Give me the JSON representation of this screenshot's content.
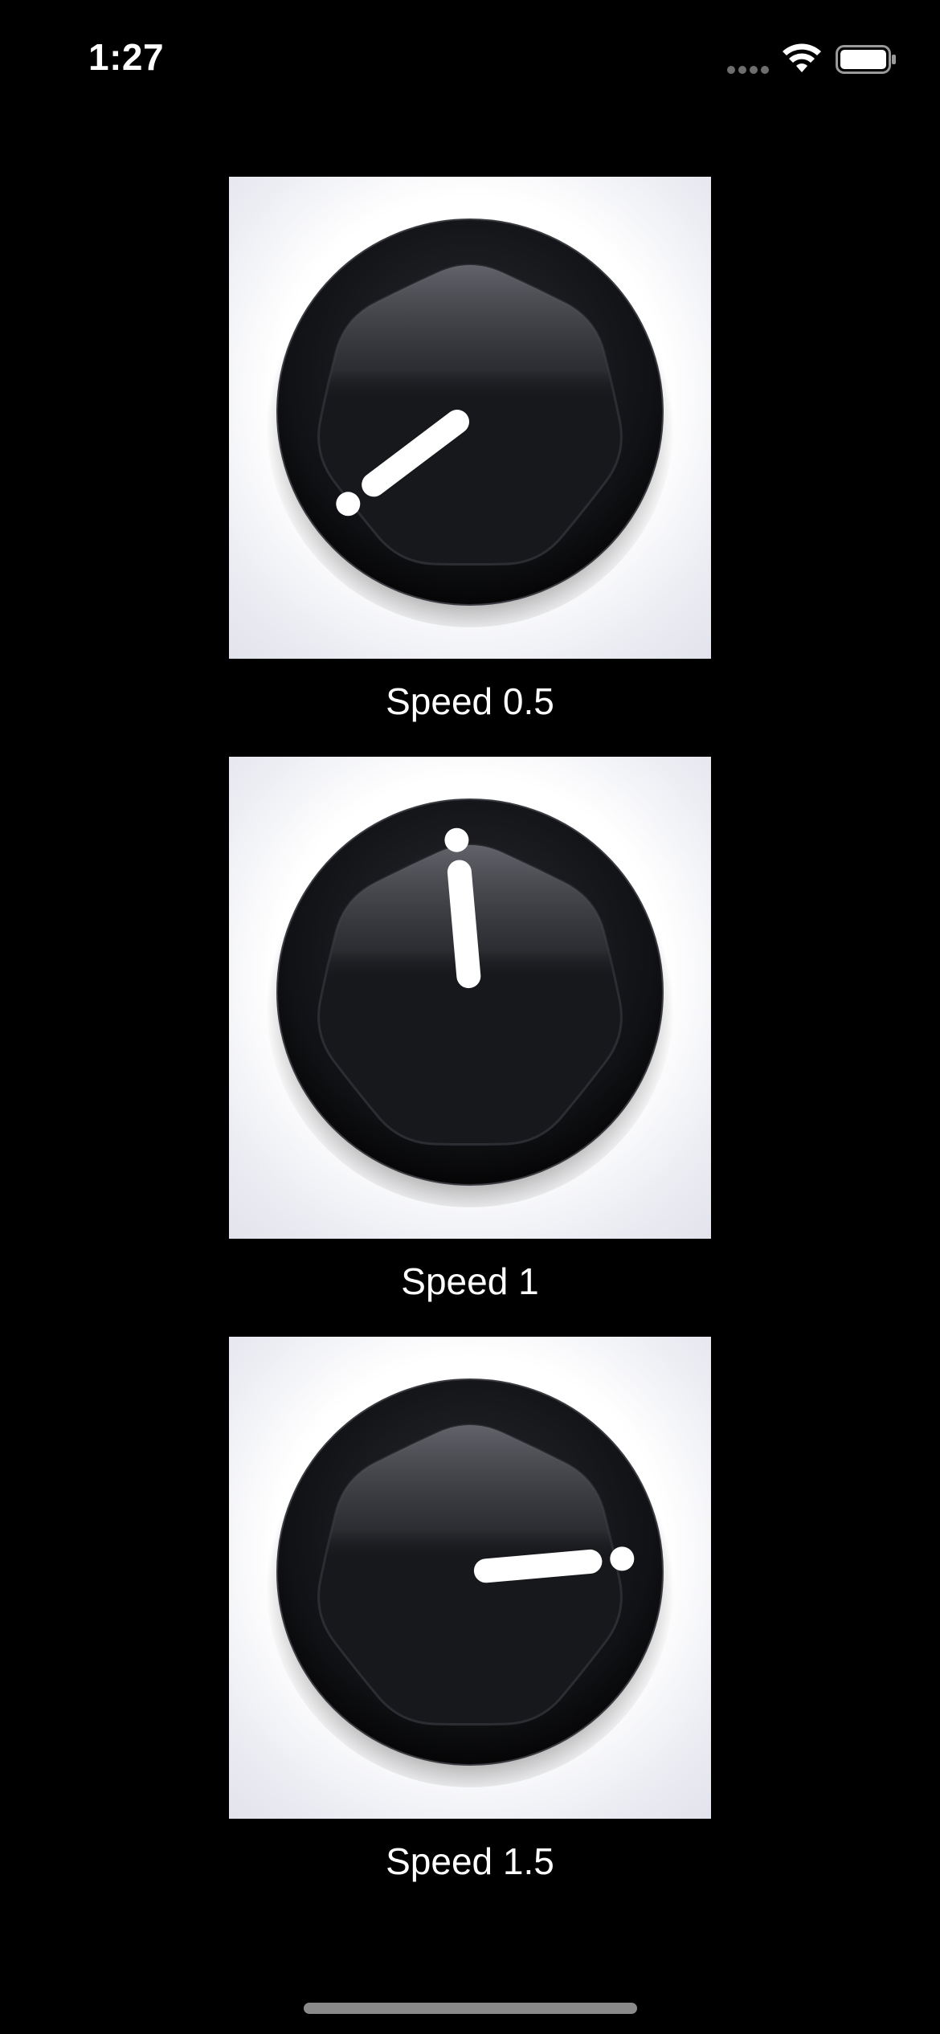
{
  "status_bar": {
    "time": "1:27",
    "icons": [
      "cellular-signal-icon",
      "wifi-icon",
      "battery-icon"
    ]
  },
  "knobs": [
    {
      "label": "Speed 0.5",
      "pointer_angle_deg": -127
    },
    {
      "label": "Speed 1",
      "pointer_angle_deg": -5
    },
    {
      "label": "Speed 1.5",
      "pointer_angle_deg": 85
    }
  ],
  "colors": {
    "background": "#000000",
    "knob_body": "#16171b",
    "pointer": "#ffffff",
    "card": "#ffffff"
  }
}
